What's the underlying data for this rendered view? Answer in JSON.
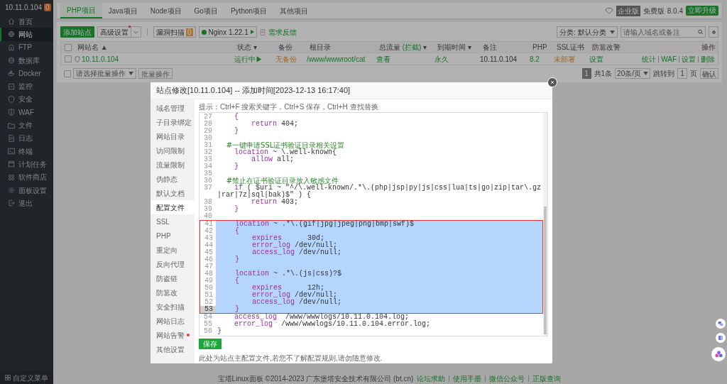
{
  "sidebar": {
    "host": "10.11.0.104",
    "badge": "0",
    "footer": "自定义菜单",
    "items": [
      {
        "label": "首页",
        "kind": "home",
        "selected": false
      },
      {
        "label": "网站",
        "kind": "globe",
        "selected": true
      },
      {
        "label": "FTP",
        "kind": "ftp",
        "selected": false
      },
      {
        "label": "数据库",
        "kind": "db",
        "selected": false
      },
      {
        "label": "Docker",
        "kind": "docker",
        "selected": false
      },
      {
        "label": "监控",
        "kind": "monitor",
        "selected": false
      },
      {
        "label": "安全",
        "kind": "shield",
        "selected": false
      },
      {
        "label": "WAF",
        "kind": "waf",
        "selected": false
      },
      {
        "label": "文件",
        "kind": "folder",
        "selected": false
      },
      {
        "label": "日志",
        "kind": "log",
        "selected": false
      },
      {
        "label": "终端",
        "kind": "terminal",
        "selected": false
      },
      {
        "label": "计划任务",
        "kind": "calendar",
        "selected": false
      },
      {
        "label": "软件商店",
        "kind": "grid",
        "selected": false
      },
      {
        "label": "面板设置",
        "kind": "gear",
        "selected": false
      },
      {
        "label": "退出",
        "kind": "exit",
        "selected": false
      }
    ]
  },
  "tabs": [
    {
      "label": "PHP项目",
      "selected": true
    },
    {
      "label": "Java项目",
      "selected": false
    },
    {
      "label": "Node项目",
      "selected": false
    },
    {
      "label": "Go项目",
      "selected": false
    },
    {
      "label": "Python项目",
      "selected": false
    },
    {
      "label": "其他项目",
      "selected": false
    }
  ],
  "edition": {
    "badge": "企业版",
    "label": "免费版",
    "version": "8.0.4",
    "upgrade": "立即升级"
  },
  "toolbar": {
    "add": "添加站点",
    "advanced": "高级设置",
    "scan": "漏洞扫描",
    "scan_count": "0",
    "nginx": "Nginx 1.22.1",
    "feedback": "需求反馈",
    "category": "分类: 默认分类",
    "search_placeholder": "请输入域名或备注"
  },
  "table": {
    "all_checked": false,
    "columns": [
      {
        "label": "网站名",
        "sort": "▲"
      },
      {
        "label": "状态",
        "sort": "▾"
      },
      {
        "label": "备份"
      },
      {
        "label": "根目录"
      },
      {
        "label": "总流量",
        "extra": "(拦截)",
        "sort": "▾"
      },
      {
        "label": "到期时间",
        "sort": "▾"
      },
      {
        "label": "备注"
      },
      {
        "label": "PHP"
      },
      {
        "label": "SSL证书"
      },
      {
        "label": "防篡改警"
      },
      {
        "label": "操作"
      }
    ],
    "rows": [
      {
        "checked": false,
        "cells": [
          {
            "text": "10.11.0.104",
            "kind": "link"
          },
          {
            "text": "运行中▶",
            "kind": "link"
          },
          {
            "text": "无备份",
            "kind": "warn"
          },
          {
            "text": "/www/wwwroot/cat",
            "kind": "link"
          },
          {
            "text": "查看",
            "kind": "link"
          },
          {
            "text": "永久",
            "kind": "link"
          },
          {
            "text": "10.11.0.104",
            "kind": "text"
          },
          {
            "text": "8.2",
            "kind": "link"
          },
          {
            "text": "未部署",
            "kind": "warn"
          },
          {
            "text": "设置",
            "kind": "link"
          }
        ],
        "actions": [
          "统计",
          "WAF",
          "设置",
          "删除"
        ]
      }
    ]
  },
  "batch": {
    "checked": false,
    "select": "请选择批量操作",
    "button": "批量操作"
  },
  "pagination": {
    "current": "1",
    "total": "共1条",
    "per_page": "20条/页",
    "jump_label": "跳转到",
    "page": "1",
    "page_unit": "页",
    "confirm": "确认"
  },
  "modal": {
    "title": "站点修改[10.11.0.104] -- 添加时间[2023-12-13 16:17:40]",
    "menu": [
      {
        "label": "域名管理",
        "selected": false,
        "alert": false
      },
      {
        "label": "子目录绑定",
        "selected": false,
        "alert": false
      },
      {
        "label": "网站目录",
        "selected": false,
        "alert": false
      },
      {
        "label": "访问限制",
        "selected": false,
        "alert": false
      },
      {
        "label": "流量限制",
        "selected": false,
        "alert": false
      },
      {
        "label": "伪静态",
        "selected": false,
        "alert": false
      },
      {
        "label": "默认文档",
        "selected": false,
        "alert": false
      },
      {
        "label": "配置文件",
        "selected": true,
        "alert": false
      },
      {
        "label": "SSL",
        "selected": false,
        "alert": false
      },
      {
        "label": "PHP",
        "selected": false,
        "alert": false
      },
      {
        "label": "重定向",
        "selected": false,
        "alert": false
      },
      {
        "label": "反向代理",
        "selected": false,
        "alert": false
      },
      {
        "label": "防盗链",
        "selected": false,
        "alert": false
      },
      {
        "label": "防篡改",
        "selected": false,
        "alert": false
      },
      {
        "label": "安全扫描",
        "selected": false,
        "alert": false
      },
      {
        "label": "网站日志",
        "selected": false,
        "alert": false
      },
      {
        "label": "网站告警",
        "selected": false,
        "alert": true
      },
      {
        "label": "其他设置",
        "selected": false,
        "alert": false
      }
    ],
    "hint": "提示：Ctrl+F 搜索关键字，Ctrl+S 保存，Ctrl+H 查找替换",
    "code": [
      {
        "n": "27",
        "text": "    {",
        "kind": "code",
        "selected": false,
        "current": false
      },
      {
        "n": "28",
        "text": "        return 404;",
        "kind": "code",
        "selected": false,
        "current": false
      },
      {
        "n": "29",
        "text": "    }",
        "kind": "code",
        "selected": false,
        "current": false
      },
      {
        "n": "30",
        "kind": "code",
        "selected": false,
        "current": false
      },
      {
        "n": "31",
        "text": "    #一键申请SSL证书验证目录相关设置",
        "kind": "comment",
        "selected": false,
        "current": false
      },
      {
        "n": "32",
        "text": "    location ~ \\.well-known{",
        "kind": "code",
        "selected": false,
        "current": false
      },
      {
        "n": "33",
        "text": "        allow all;",
        "kind": "code",
        "selected": false,
        "current": false
      },
      {
        "n": "34",
        "text": "    }",
        "kind": "code",
        "selected": false,
        "current": false
      },
      {
        "n": "35",
        "kind": "code",
        "selected": false,
        "current": false
      },
      {
        "n": "36",
        "text": "    #禁止在证书验证目录放入敏感文件",
        "kind": "comment",
        "selected": false,
        "current": false
      },
      {
        "n": "37",
        "text": "    if ( $uri ~ \"^/\\.well-known/.*\\.(php|jsp|py|js|css|lua|ts|go|zip|tar\\.gz|rar|7z|sql|bak)$\" ) {",
        "kind": "code",
        "selected": false,
        "current": false
      },
      {
        "n": "38",
        "text": "        return 403;",
        "kind": "code",
        "selected": false,
        "current": false
      },
      {
        "n": "39",
        "text": "    }",
        "kind": "code",
        "selected": false,
        "current": false
      },
      {
        "n": "40",
        "kind": "code",
        "selected": false,
        "current": false
      },
      {
        "n": "41",
        "text": "    location ~ .*\\.(gif|jpg|jpeg|png|bmp|swf)$",
        "kind": "code",
        "selected": true,
        "current": false
      },
      {
        "n": "42",
        "text": "    {",
        "kind": "code",
        "selected": true,
        "current": false
      },
      {
        "n": "43",
        "text": "        expires      30d;",
        "kind": "code",
        "selected": true,
        "current": false
      },
      {
        "n": "44",
        "text": "        error_log /dev/null;",
        "kind": "code",
        "selected": true,
        "current": false
      },
      {
        "n": "45",
        "text": "        access_log /dev/null;",
        "kind": "code",
        "selected": true,
        "current": false
      },
      {
        "n": "46",
        "text": "    }",
        "kind": "code",
        "selected": true,
        "current": false
      },
      {
        "n": "47",
        "kind": "code",
        "selected": true,
        "current": false
      },
      {
        "n": "48",
        "text": "    location ~ .*\\.(js|css)?$",
        "kind": "code",
        "selected": true,
        "current": false
      },
      {
        "n": "49",
        "text": "    {",
        "kind": "code",
        "selected": true,
        "current": false
      },
      {
        "n": "50",
        "text": "        expires      12h;",
        "kind": "code",
        "selected": true,
        "current": false
      },
      {
        "n": "51",
        "text": "        error_log /dev/null;",
        "kind": "code",
        "selected": true,
        "current": false
      },
      {
        "n": "52",
        "text": "        access_log /dev/null;",
        "kind": "code",
        "selected": true,
        "current": false
      },
      {
        "n": "53",
        "text": "    }",
        "kind": "code",
        "selected": true,
        "current": true
      },
      {
        "n": "54",
        "text": "    access_log  /www/wwwlogs/10.11.0.104.log;",
        "kind": "code",
        "selected": false,
        "current": false
      },
      {
        "n": "55",
        "text": "    error_log  /www/wwwlogs/10.11.0.104.error.log;",
        "kind": "code",
        "selected": false,
        "current": false
      },
      {
        "n": "56",
        "text": "}",
        "kind": "code",
        "selected": false,
        "current": false
      }
    ],
    "save": "保存",
    "note": "此处为站点主配置文件,若您不了解配置规则,请勿随意修改."
  },
  "footer": {
    "copyright": "宝塔Linux面板 ©2014-2023 广东堡塔安全技术有限公司 (bt.cn)",
    "links": [
      "论坛求助",
      "使用手册",
      "微信公众号",
      "正版查询"
    ]
  }
}
